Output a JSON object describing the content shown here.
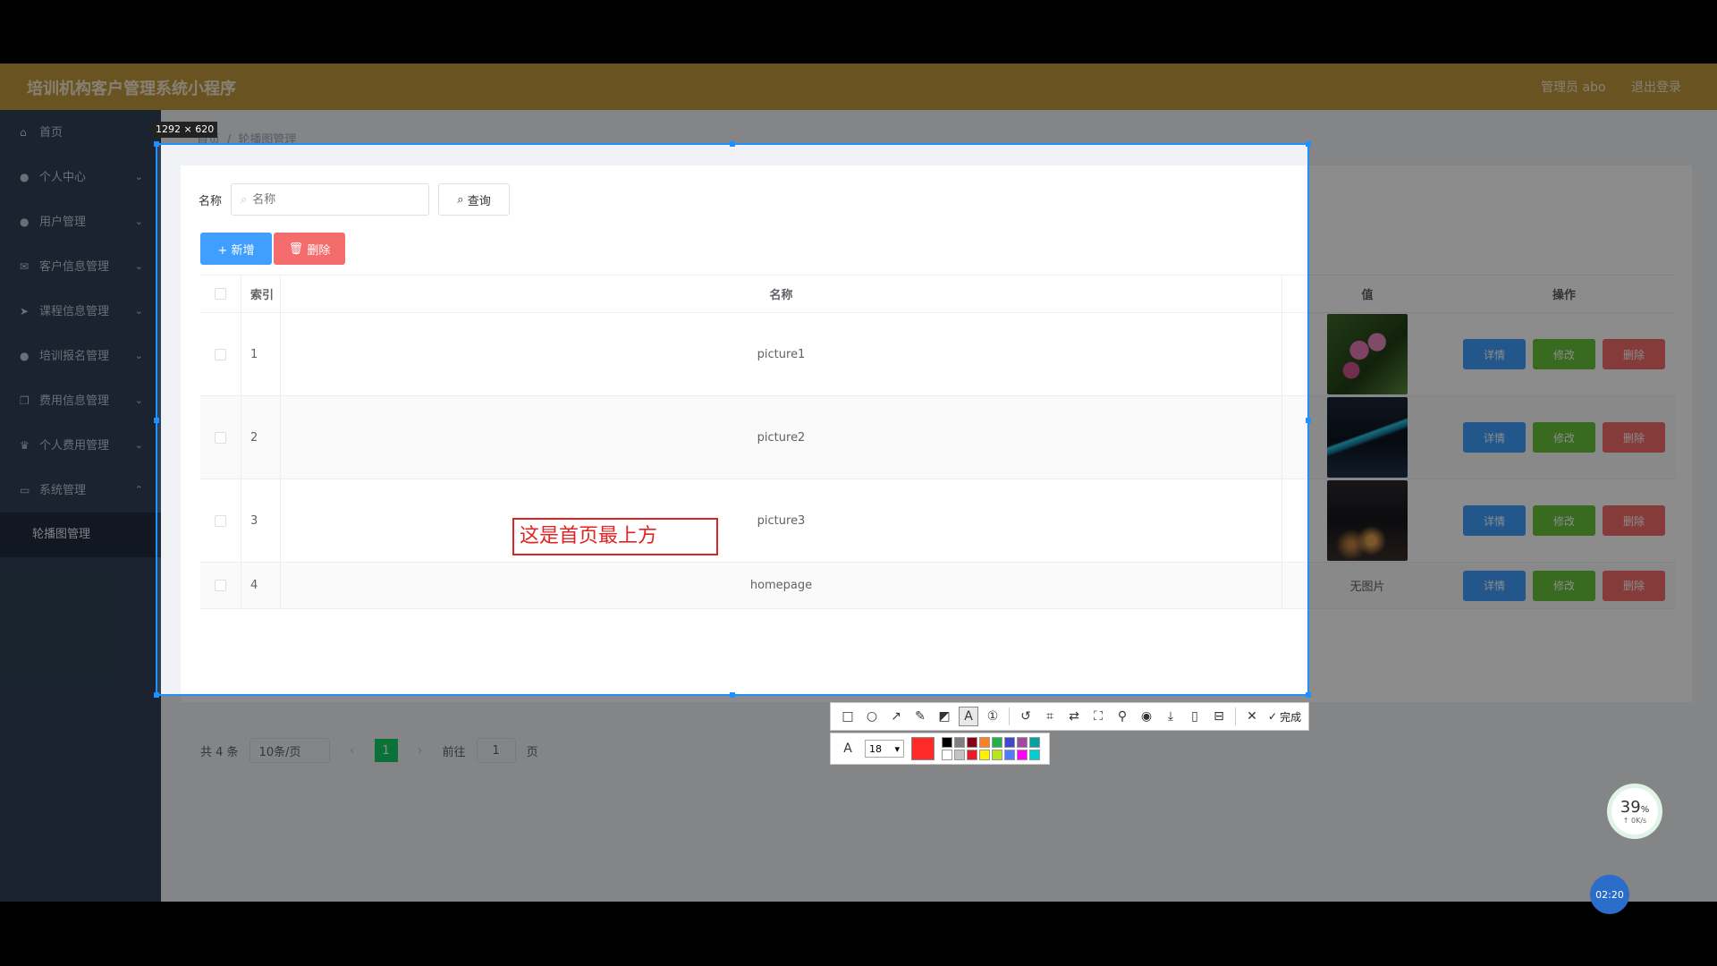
{
  "app": {
    "title": "培训机构客户管理系统小程序",
    "user": "管理员 abo",
    "logout": "退出登录"
  },
  "sidebar": {
    "items": [
      {
        "label": "首页",
        "icon": "home-icon"
      },
      {
        "label": "个人中心",
        "icon": "user-icon"
      },
      {
        "label": "用户管理",
        "icon": "user-icon"
      },
      {
        "label": "客户信息管理",
        "icon": "mail-icon"
      },
      {
        "label": "课程信息管理",
        "icon": "send-icon"
      },
      {
        "label": "培训报名管理",
        "icon": "user-icon"
      },
      {
        "label": "费用信息管理",
        "icon": "copy-icon"
      },
      {
        "label": "个人费用管理",
        "icon": "trophy-icon"
      },
      {
        "label": "系统管理",
        "icon": "monitor-icon"
      }
    ],
    "submenu": {
      "label": "轮播图管理"
    }
  },
  "breadcrumb": {
    "home": "首页",
    "sep": "/",
    "current": "轮播图管理"
  },
  "filter": {
    "label": "名称",
    "placeholder": "名称",
    "query_label": "查询"
  },
  "toolbar": {
    "add_label": "+ 新增",
    "delete_label": "删除"
  },
  "table": {
    "headers": {
      "index": "索引",
      "name": "名称",
      "value": "值",
      "ops": "操作"
    },
    "rows": [
      {
        "index": "1",
        "name": "picture1",
        "value": ""
      },
      {
        "index": "2",
        "name": "picture2",
        "value": ""
      },
      {
        "index": "3",
        "name": "picture3",
        "value": ""
      },
      {
        "index": "4",
        "name": "homepage",
        "value": "无图片"
      }
    ],
    "ops": {
      "detail": "详情",
      "edit": "修改",
      "delete": "删除"
    }
  },
  "pager": {
    "total": "共 4 条",
    "size": "10条/页",
    "page": "1",
    "goto": "前往",
    "goto_value": "1",
    "unit": "页"
  },
  "screenshot_tool": {
    "size_label": "1292 × 620",
    "annotation_text": "这是首页最上方",
    "done_label": "完成",
    "font_size": "18",
    "current_color": "#ff2a2a",
    "palette": [
      "#000000",
      "#7f7f7f",
      "#880015",
      "#ff7f27",
      "#22b14c",
      "#3f48cc",
      "#a349a4",
      "#00a2a2",
      "#ffffff",
      "#c3c3c3",
      "#ed1c24",
      "#fff200",
      "#b5e61d",
      "#4d7cff",
      "#ff00ff",
      "#00d0d0"
    ]
  },
  "widget": {
    "percent": "39",
    "percent_sign": "%",
    "speed": "↑ 0K/s"
  },
  "clock": {
    "time": "02:20"
  },
  "colors": {
    "header": "#bf9a3d",
    "sidebar": "#304156",
    "selection": "#1e90ff",
    "annotation": "#e02424"
  }
}
